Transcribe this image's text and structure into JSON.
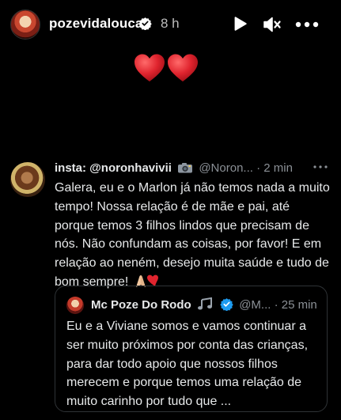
{
  "story": {
    "username": "pozevidalouca",
    "time_ago": "8 h",
    "icons": {
      "verified": "verified-badge-icon",
      "play": "play-icon",
      "mute": "speaker-muted-icon",
      "more": "more-horizontal-icon"
    },
    "hearts": "❤️❤️"
  },
  "tweet": {
    "display_name": "insta: @noronhavivii",
    "handle_time": "@Noron... · 2 min",
    "text": "Galera, eu e o Marlon já não temos nada a muito tempo! Nossa relação é de mãe e pai, até porque temos 3 filhos lindos que precisam de nós. Não confundam as coisas, por favor! E em relação ao neném, desejo muita saúde e tudo de bom sempre!",
    "emojis": "🙏🏼❤️",
    "quote": {
      "display_name": "Mc Poze Do Rodo",
      "handle_time": "@M... · 25 min",
      "text": "Eu e a Viviane somos e vamos continuar a ser muito próximos por conta das crianças, para dar todo apoio que nossos filhos merecem e porque temos uma relação de muito carinho por tudo que ..."
    }
  },
  "colors": {
    "background": "#000000",
    "text": "#e7e9ea",
    "muted": "#8b9096",
    "verified_blue": "#1d9bf0",
    "heart_red": "#e0242e"
  }
}
